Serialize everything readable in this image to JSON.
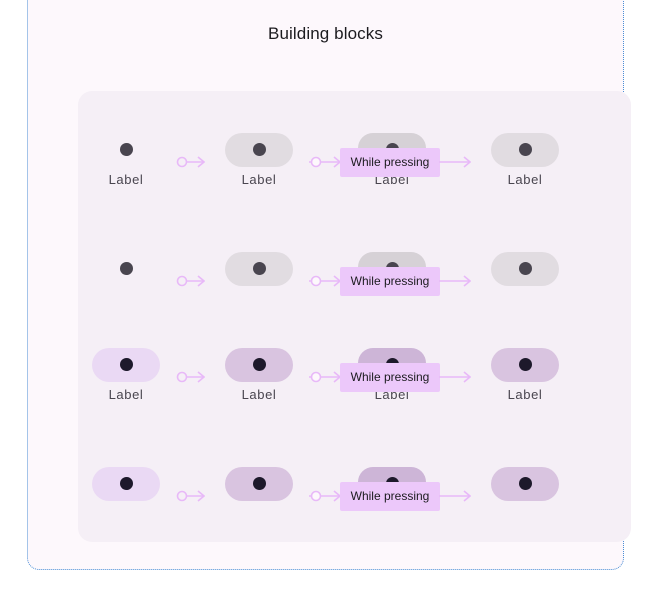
{
  "title": "Building blocks",
  "label_text": "Label",
  "press_text": "While pressing",
  "colors": {
    "frame_bg": "#fdf8fc",
    "panel_bg": "#f5eff6",
    "neutral_pill": "#e1dce1",
    "neutral_pill_pressed": "#d6d1d6",
    "purple_light": "#ead9f4",
    "purple_pill": "#d9c4e0",
    "purple_pill_pressed": "#cdb5d7",
    "dot_neutral": "#49454f",
    "dot_purple": "#1d192b",
    "accent": "#e8b9f8",
    "press_bg": "#ecc8fa"
  },
  "rows": [
    {
      "variant": "neutral",
      "labels": [
        "Label",
        "Label",
        "Label",
        "Label"
      ]
    },
    {
      "variant": "neutral",
      "labels": []
    },
    {
      "variant": "purple",
      "labels": [
        "Label",
        "Label",
        "Label",
        "Label"
      ]
    },
    {
      "variant": "purple",
      "labels": []
    }
  ]
}
